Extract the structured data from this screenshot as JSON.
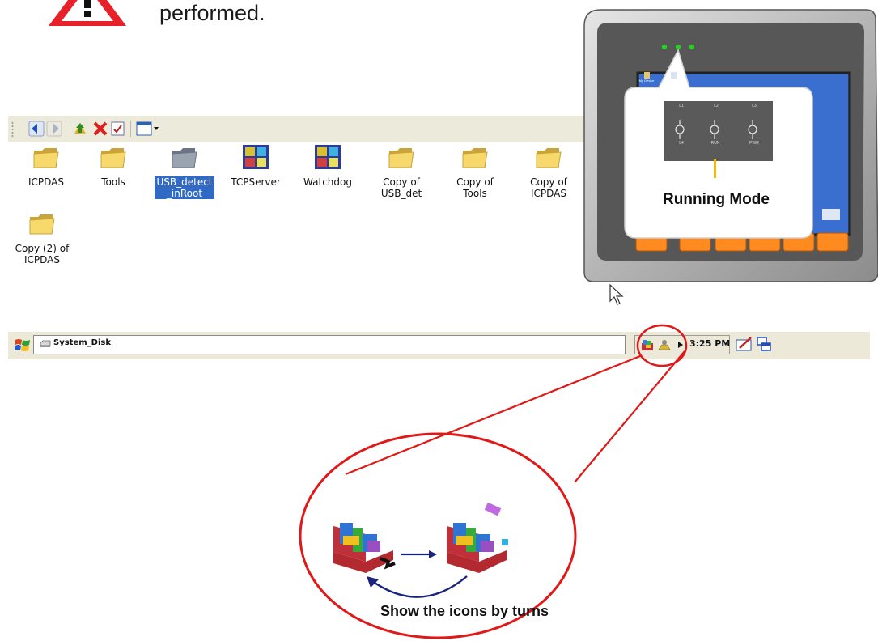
{
  "heading": {
    "text": "performed."
  },
  "explorer": {
    "files": [
      {
        "name": "ICPDAS",
        "icon": "folder-icon",
        "selected": false
      },
      {
        "name": "Tools",
        "icon": "folder-icon",
        "selected": false
      },
      {
        "name": "USB_detect\n_inRoot",
        "icon": "folder-gray-icon",
        "selected": true
      },
      {
        "name": "TCPServer",
        "icon": "app-cube-icon",
        "selected": false
      },
      {
        "name": "Watchdog",
        "icon": "app-cube-icon",
        "selected": false
      },
      {
        "name": "Copy of\nUSB_det",
        "icon": "folder-icon",
        "selected": false
      },
      {
        "name": "Copy of\nTools",
        "icon": "folder-icon",
        "selected": false
      },
      {
        "name": "Copy of\nICPDAS",
        "icon": "folder-icon",
        "selected": false
      },
      {
        "name": "Copy (2) of\nICPDAS",
        "icon": "folder-icon",
        "selected": false
      }
    ]
  },
  "taskbar": {
    "address": "System_Disk",
    "clock": "3:25 PM"
  },
  "device": {
    "leds": [
      "L1",
      "L2",
      "L3"
    ],
    "led_labels": [
      "L4",
      "RUN",
      "PWR"
    ],
    "callout": "Running Mode",
    "screen_icons": [
      "My Device",
      "TaskMgr"
    ]
  },
  "zoom": {
    "caption": "Show the icons by turns"
  },
  "colors": {
    "annotation": "#e01818",
    "selection": "#316ac5",
    "arrow": "#1a237e",
    "led": "#22d022"
  }
}
